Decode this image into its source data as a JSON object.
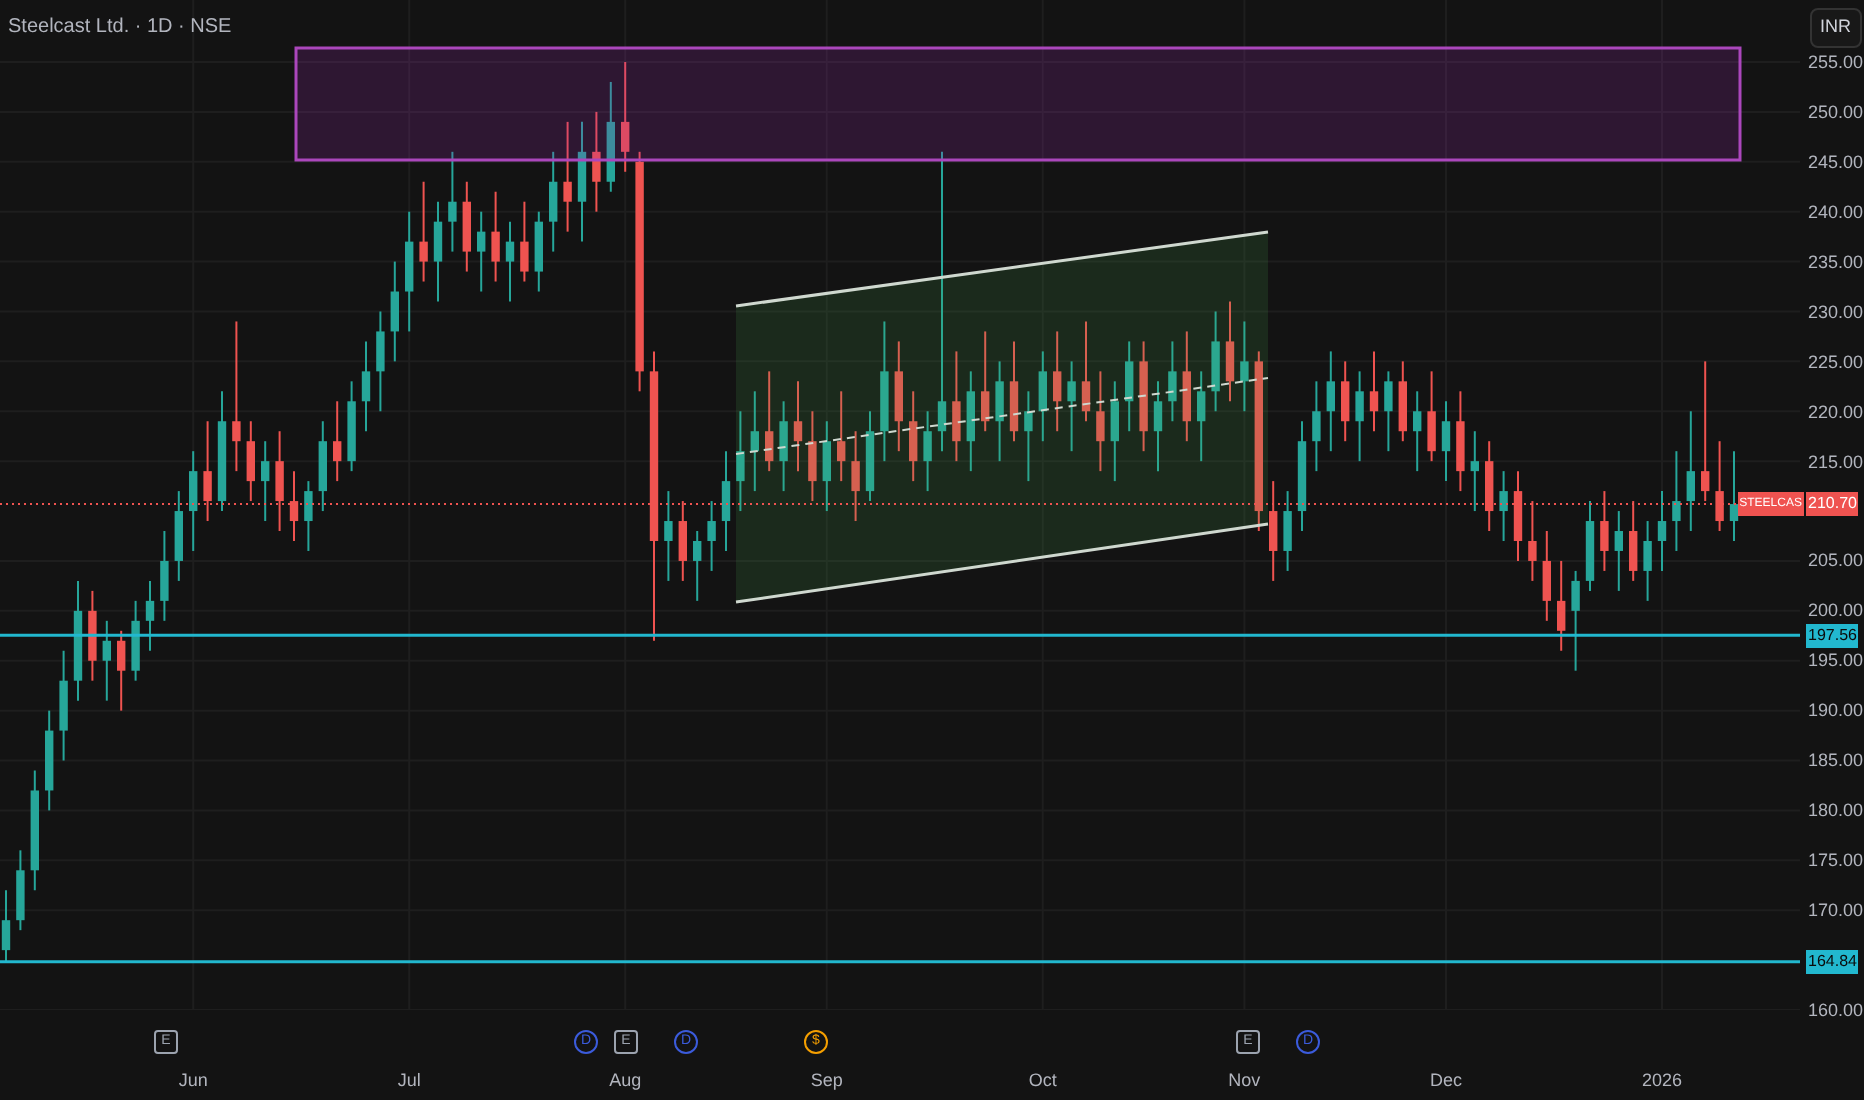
{
  "title": "Steelcast Ltd. · 1D · NSE",
  "currency": "INR",
  "price_lines": [
    {
      "kind": "last",
      "label": "210.70",
      "tag": "STEELCAS"
    },
    {
      "kind": "level",
      "label": "197.56"
    },
    {
      "kind": "level",
      "label": "164.84"
    }
  ],
  "chart_data": {
    "type": "candlestick",
    "ylim": [
      160,
      255
    ],
    "grid": true,
    "yticks": [
      {
        "value": 255,
        "label": "255.00"
      },
      {
        "value": 250,
        "label": "250.00"
      },
      {
        "value": 245,
        "label": "245.00"
      },
      {
        "value": 240,
        "label": "240.00"
      },
      {
        "value": 235,
        "label": "235.00"
      },
      {
        "value": 230,
        "label": "230.00"
      },
      {
        "value": 225,
        "label": "225.00"
      },
      {
        "value": 220,
        "label": "220.00"
      },
      {
        "value": 215,
        "label": "215.00"
      },
      {
        "value": 205,
        "label": "205.00"
      },
      {
        "value": 200,
        "label": "200.00"
      },
      {
        "value": 195,
        "label": "195.00"
      },
      {
        "value": 190,
        "label": "190.00"
      },
      {
        "value": 185,
        "label": "185.00"
      },
      {
        "value": 180,
        "label": "180.00"
      },
      {
        "value": 175,
        "label": "175.00"
      },
      {
        "value": 170,
        "label": "170.00"
      },
      {
        "value": 160,
        "label": "160.00"
      }
    ],
    "categories": [
      null,
      null,
      null,
      null,
      null,
      null,
      null,
      null,
      null,
      null,
      null,
      null,
      null,
      "Jun",
      null,
      null,
      null,
      null,
      null,
      null,
      null,
      null,
      null,
      null,
      null,
      null,
      null,
      null,
      "Jul",
      null,
      null,
      null,
      null,
      null,
      null,
      null,
      null,
      null,
      null,
      null,
      null,
      null,
      null,
      "Aug",
      null,
      null,
      null,
      null,
      null,
      null,
      null,
      null,
      null,
      null,
      null,
      null,
      null,
      "Sep",
      null,
      null,
      null,
      null,
      null,
      null,
      null,
      null,
      null,
      null,
      null,
      null,
      null,
      null,
      "Oct",
      null,
      null,
      null,
      null,
      null,
      null,
      null,
      null,
      null,
      null,
      null,
      null,
      null,
      "Nov",
      null,
      null,
      null,
      null,
      null,
      null,
      null,
      null,
      null,
      null,
      null,
      null,
      null,
      "Dec",
      null,
      null,
      null,
      null,
      null,
      null,
      null,
      null,
      null,
      null,
      null,
      null,
      null,
      null,
      "2026",
      null,
      null,
      null,
      null,
      null
    ],
    "ohlc": [
      [
        166,
        172,
        164.8,
        169
      ],
      [
        169,
        176,
        168,
        174
      ],
      [
        174,
        184,
        172,
        182
      ],
      [
        182,
        190,
        180,
        188
      ],
      [
        188,
        196,
        185,
        193
      ],
      [
        193,
        203,
        191,
        200
      ],
      [
        200,
        202,
        193,
        195
      ],
      [
        195,
        199,
        191,
        197
      ],
      [
        197,
        198,
        190,
        194
      ],
      [
        194,
        201,
        193,
        199
      ],
      [
        199,
        203,
        196,
        201
      ],
      [
        201,
        208,
        199,
        205
      ],
      [
        205,
        212,
        203,
        210
      ],
      [
        210,
        216,
        206,
        214
      ],
      [
        214,
        219,
        209,
        211
      ],
      [
        211,
        222,
        210,
        219
      ],
      [
        219,
        229,
        214,
        217
      ],
      [
        217,
        219,
        211,
        213
      ],
      [
        213,
        217,
        209,
        215
      ],
      [
        215,
        218,
        208,
        211
      ],
      [
        211,
        214,
        207,
        209
      ],
      [
        209,
        213,
        206,
        212
      ],
      [
        212,
        219,
        210,
        217
      ],
      [
        217,
        221,
        213,
        215
      ],
      [
        215,
        223,
        214,
        221
      ],
      [
        221,
        227,
        218,
        224
      ],
      [
        224,
        230,
        220,
        228
      ],
      [
        228,
        235,
        225,
        232
      ],
      [
        232,
        240,
        228,
        237
      ],
      [
        237,
        243,
        233,
        235
      ],
      [
        235,
        241,
        231,
        239
      ],
      [
        239,
        246,
        236,
        241
      ],
      [
        241,
        243,
        234,
        236
      ],
      [
        236,
        240,
        232,
        238
      ],
      [
        238,
        242,
        233,
        235
      ],
      [
        235,
        239,
        231,
        237
      ],
      [
        237,
        241,
        233,
        234
      ],
      [
        234,
        240,
        232,
        239
      ],
      [
        239,
        246,
        236,
        243
      ],
      [
        243,
        249,
        238,
        241
      ],
      [
        241,
        249,
        237,
        246
      ],
      [
        246,
        250,
        240,
        243
      ],
      [
        243,
        253,
        242,
        249
      ],
      [
        249,
        255,
        244,
        246
      ],
      [
        245,
        246,
        222,
        224
      ],
      [
        224,
        226,
        197,
        207
      ],
      [
        207,
        212,
        203,
        209
      ],
      [
        209,
        211,
        203,
        205
      ],
      [
        205,
        208,
        201,
        207
      ],
      [
        207,
        211,
        204,
        209
      ],
      [
        209,
        216,
        206,
        213
      ],
      [
        213,
        220,
        210,
        216
      ],
      [
        216,
        222,
        212,
        218
      ],
      [
        218,
        224,
        214,
        215
      ],
      [
        215,
        221,
        212,
        219
      ],
      [
        219,
        223,
        214,
        217
      ],
      [
        217,
        220,
        211,
        213
      ],
      [
        213,
        219,
        210,
        217
      ],
      [
        217,
        222,
        213,
        215
      ],
      [
        215,
        218,
        209,
        212
      ],
      [
        212,
        220,
        211,
        218
      ],
      [
        218,
        229,
        215,
        224
      ],
      [
        224,
        227,
        216,
        219
      ],
      [
        219,
        222,
        213,
        215
      ],
      [
        215,
        220,
        212,
        218
      ],
      [
        218,
        246,
        216,
        221
      ],
      [
        221,
        226,
        215,
        217
      ],
      [
        217,
        224,
        214,
        222
      ],
      [
        222,
        228,
        218,
        219
      ],
      [
        219,
        225,
        215,
        223
      ],
      [
        223,
        227,
        217,
        218
      ],
      [
        218,
        222,
        213,
        220
      ],
      [
        220,
        226,
        217,
        224
      ],
      [
        224,
        228,
        218,
        221
      ],
      [
        221,
        225,
        216,
        223
      ],
      [
        223,
        229,
        219,
        220
      ],
      [
        220,
        224,
        214,
        217
      ],
      [
        217,
        223,
        213,
        221
      ],
      [
        221,
        227,
        218,
        225
      ],
      [
        225,
        227,
        216,
        218
      ],
      [
        218,
        223,
        214,
        221
      ],
      [
        221,
        227,
        219,
        224
      ],
      [
        224,
        228,
        217,
        219
      ],
      [
        219,
        224,
        215,
        222
      ],
      [
        222,
        230,
        220,
        227
      ],
      [
        227,
        231,
        221,
        223
      ],
      [
        223,
        229,
        220,
        225
      ],
      [
        225,
        226,
        208,
        210
      ],
      [
        210,
        213,
        203,
        206
      ],
      [
        206,
        212,
        204,
        210
      ],
      [
        210,
        219,
        208,
        217
      ],
      [
        217,
        223,
        214,
        220
      ],
      [
        220,
        226,
        216,
        223
      ],
      [
        223,
        225,
        217,
        219
      ],
      [
        219,
        224,
        215,
        222
      ],
      [
        222,
        226,
        218,
        220
      ],
      [
        220,
        224,
        216,
        223
      ],
      [
        223,
        225,
        217,
        218
      ],
      [
        218,
        222,
        214,
        220
      ],
      [
        220,
        224,
        215,
        216
      ],
      [
        216,
        221,
        213,
        219
      ],
      [
        219,
        222,
        212,
        214
      ],
      [
        214,
        218,
        210,
        215
      ],
      [
        215,
        217,
        208,
        210
      ],
      [
        210,
        214,
        207,
        212
      ],
      [
        212,
        214,
        205,
        207
      ],
      [
        207,
        211,
        203,
        205
      ],
      [
        205,
        208,
        199,
        201
      ],
      [
        201,
        205,
        196,
        198
      ],
      [
        200,
        204,
        194,
        203
      ],
      [
        203,
        211,
        202,
        209
      ],
      [
        209,
        212,
        204,
        206
      ],
      [
        206,
        210,
        202,
        208
      ],
      [
        208,
        211,
        203,
        204
      ],
      [
        204,
        209,
        201,
        207
      ],
      [
        207,
        212,
        204,
        209
      ],
      [
        209,
        216,
        206,
        211
      ],
      [
        211,
        220,
        208,
        214
      ],
      [
        214,
        225,
        211,
        212
      ],
      [
        212,
        217,
        208,
        209
      ],
      [
        209,
        216,
        207,
        210.7
      ]
    ]
  },
  "events": [
    {
      "kind": "earnings",
      "label": "E"
    },
    {
      "kind": "dividend",
      "label": "D"
    },
    {
      "kind": "earnings",
      "label": "E"
    },
    {
      "kind": "dividend",
      "label": "D"
    },
    {
      "kind": "split",
      "label": "$"
    },
    {
      "kind": "earnings",
      "label": "E"
    },
    {
      "kind": "dividend",
      "label": "D"
    }
  ]
}
